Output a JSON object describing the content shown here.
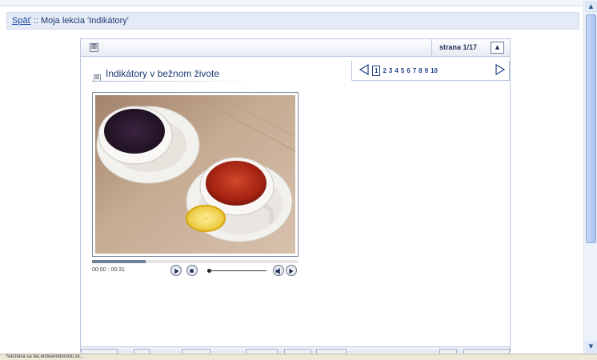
{
  "header": {
    "back_link": "Späť",
    "separator": " :: ",
    "lesson_label": "Moja lekcia 'Indikátory'"
  },
  "toolbar": {
    "close_symbol": "⊠",
    "page_indicator": "strana 1/17",
    "collapse_symbol": "▲"
  },
  "lesson": {
    "title_icon": "⊠",
    "title": "Indikátory v bežnom živote"
  },
  "pager": {
    "pages": [
      "1",
      "2",
      "3",
      "4",
      "5",
      "6",
      "7",
      "8",
      "9",
      "10"
    ],
    "active_page": "1"
  },
  "video": {
    "time": "00:00 : 00:31",
    "progress_fraction": 0.26,
    "subject": "two cups of tea on saucers with lemon slice"
  },
  "status": {
    "text": "Načítava sa las.elsteavodovosti.sk..."
  },
  "colors": {
    "header_bg": "#e4ebf6",
    "link": "#1f46a8",
    "title": "#1d3a78",
    "scroll_thumb": "#a9c2ee"
  },
  "icons": {
    "prev_page": "triangle-left-icon",
    "next_page": "triangle-right-icon",
    "play": "play-icon",
    "stop": "stop-icon",
    "volume_down": "volume-down-icon",
    "volume_up": "volume-up-icon"
  }
}
